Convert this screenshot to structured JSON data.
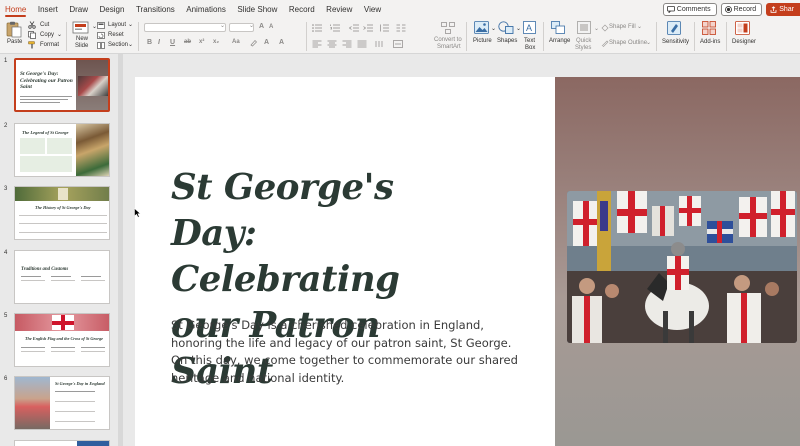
{
  "tabs": [
    "Home",
    "Insert",
    "Draw",
    "Design",
    "Transitions",
    "Animations",
    "Slide Show",
    "Record",
    "Review",
    "View"
  ],
  "tab_right": {
    "comments": "Comments",
    "record": "Record",
    "share": "Shar"
  },
  "ribbon": {
    "paste": "Paste",
    "cut": "Cut",
    "copy": "Copy",
    "format": "Format",
    "new_slide_1": "New",
    "new_slide_2": "Slide",
    "layout": "Layout",
    "reset": "Reset",
    "section": "Section",
    "convert_1": "Convert to",
    "convert_2": "SmartArt",
    "picture": "Picture",
    "shapes": "Shapes",
    "textbox_1": "Text",
    "textbox_2": "Box",
    "arrange": "Arrange",
    "quick_1": "Quick",
    "quick_2": "Styles",
    "shape_fill": "Shape Fill",
    "shape_outline": "Shape Outline",
    "sensitivity": "Sensitivity",
    "addins": "Add-ins",
    "designer": "Designer"
  },
  "thumbnails": [
    {
      "num": "1",
      "title": "St George's Day: Celebrating our Patron Saint"
    },
    {
      "num": "2",
      "title": "The Legend of St George"
    },
    {
      "num": "3",
      "title": "The History of St George's Day"
    },
    {
      "num": "4",
      "title": "Traditions and Customs"
    },
    {
      "num": "5",
      "title": "The English Flag and the Cross of St George"
    },
    {
      "num": "6",
      "title": "St George's Day in England"
    }
  ],
  "slide": {
    "title": "St George's Day: Celebrating our Patron Saint",
    "body": "St George's Day is a cherished celebration in England, honoring the life and legacy of our patron saint, St George. On this day, we come together to commemorate our shared heritage and national identity."
  },
  "colors": {
    "accent": "#c43e1c",
    "title": "#2b3a34"
  }
}
